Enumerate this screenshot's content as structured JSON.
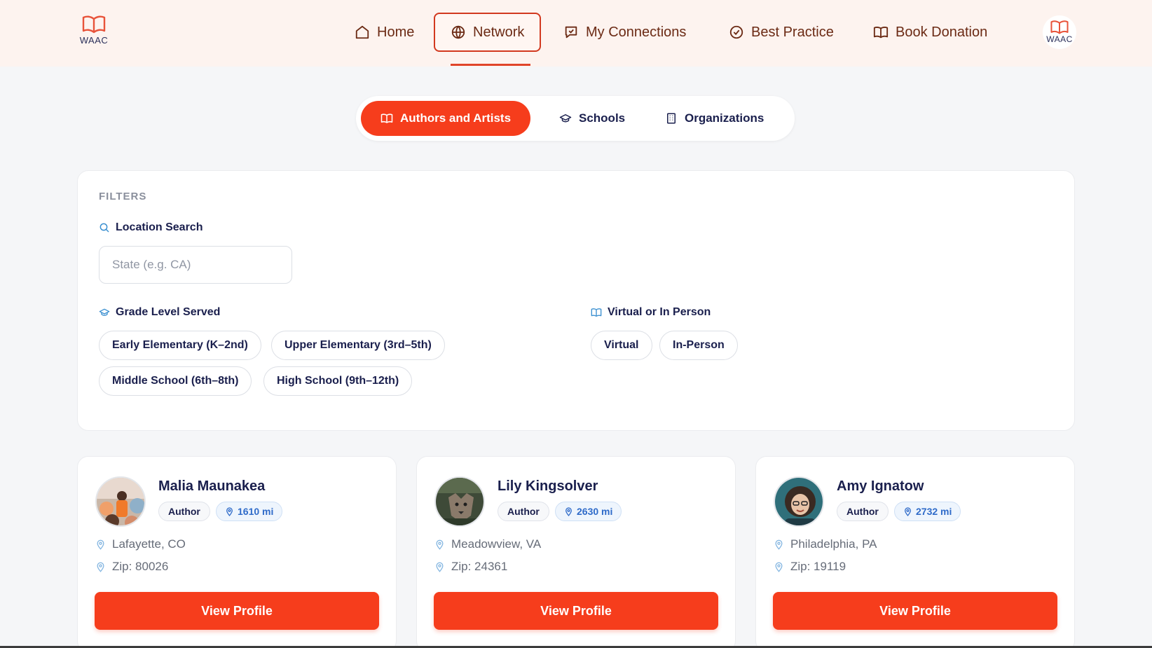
{
  "header": {
    "logo_text": "WAAC",
    "nav": [
      {
        "label": "Home",
        "icon": "home-icon"
      },
      {
        "label": "Network",
        "icon": "globe-icon",
        "active": true
      },
      {
        "label": "My Connections",
        "icon": "message-check-icon"
      },
      {
        "label": "Best Practice",
        "icon": "check-circle-icon"
      },
      {
        "label": "Book Donation",
        "icon": "book-open-icon"
      }
    ],
    "profile_logo_text": "WAAC"
  },
  "tabs": [
    {
      "label": "Authors and Artists",
      "icon": "book-open-icon",
      "active": true
    },
    {
      "label": "Schools",
      "icon": "graduation-cap-icon"
    },
    {
      "label": "Organizations",
      "icon": "building-icon"
    }
  ],
  "filters": {
    "title": "FILTERS",
    "location_label": "Location Search",
    "location_placeholder": "State (e.g. CA)",
    "grade_label": "Grade Level Served",
    "grade_options": [
      "Early Elementary (K–2nd)",
      "Upper Elementary (3rd–5th)",
      "Middle School (6th–8th)",
      "High School (9th–12th)"
    ],
    "mode_label": "Virtual or In Person",
    "mode_options": [
      "Virtual",
      "In-Person"
    ]
  },
  "cards": [
    {
      "name": "Malia Maunakea",
      "role": "Author",
      "distance": "1610 mi",
      "location": "Lafayette, CO",
      "zip": "Zip: 80026",
      "button": "View Profile"
    },
    {
      "name": "Lily Kingsolver",
      "role": "Author",
      "distance": "2630 mi",
      "location": "Meadowview, VA",
      "zip": "Zip: 24361",
      "button": "View Profile"
    },
    {
      "name": "Amy Ignatow",
      "role": "Author",
      "distance": "2732 mi",
      "location": "Philadelphia, PA",
      "zip": "Zip: 19119",
      "button": "View Profile"
    }
  ],
  "colors": {
    "accent": "#f63d1c",
    "nav_text": "#6b2a14",
    "header_bg": "#fdf3ef",
    "badge_blue": "#2f6bc9"
  }
}
